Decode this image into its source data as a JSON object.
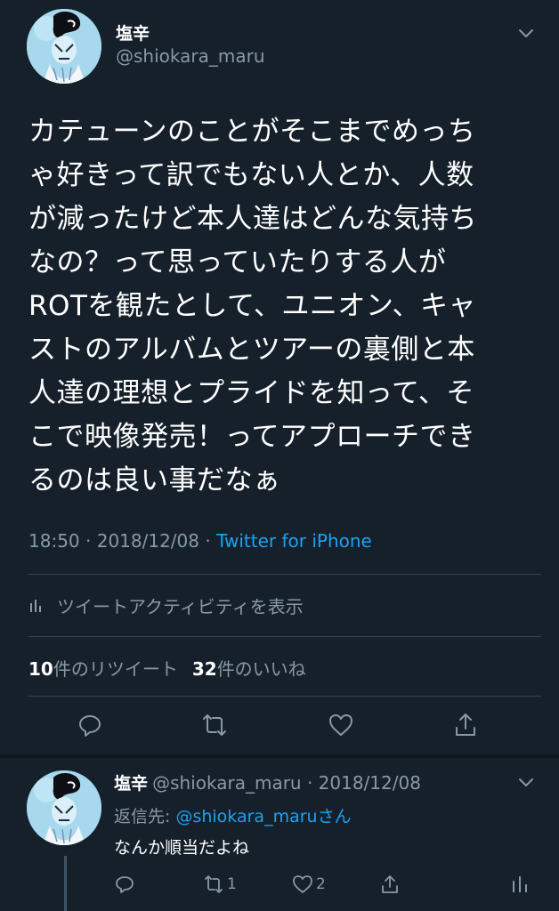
{
  "tweet": {
    "author": {
      "display_name": "塩辛",
      "handle": "@shiokara_maru"
    },
    "text_lines": [
      "カテューンのことがそこまでめっち",
      "ゃ好きって訳でもない人とか、人数",
      "が減ったけど本人達はどんな気持ち",
      "なの？って思っていたりする人が",
      "ROTを観たとして、ユニオン、キャ",
      "ストのアルバムとツアーの裏側と本",
      "人達の理想とプライドを知って、そ",
      "こで映像発売！ってアプローチでき",
      "るのは良い事だなぁ"
    ],
    "time": "18:50",
    "date": "2018/12/08",
    "separator": "·",
    "source": "Twitter for iPhone",
    "activity_label": "ツイートアクティビティを表示",
    "retweet_count": "10",
    "retweet_label": "件のリツイート",
    "like_count": "32",
    "like_label": "件のいいね"
  },
  "icons": {
    "more": "chevron-down-icon",
    "activity": "bar-chart-icon",
    "reply": "speech-bubble-icon",
    "retweet": "retweet-arrows-icon",
    "like": "heart-icon",
    "share": "share-arrow-icon"
  },
  "reply": {
    "author": {
      "display_name": "塩辛",
      "handle_and_date": "@shiokara_maru · 2018/12/08"
    },
    "reply_to_prefix": "返信先: ",
    "reply_to_handle": "@shiokara_maru",
    "reply_to_suffix": "さん",
    "text": "なんか順当だよね",
    "retweet_count": "1",
    "like_count": "2"
  },
  "colors": {
    "background": "#15202b",
    "secondary_text": "#8899a6",
    "accent": "#1da1f2",
    "divider": "#38444d"
  }
}
